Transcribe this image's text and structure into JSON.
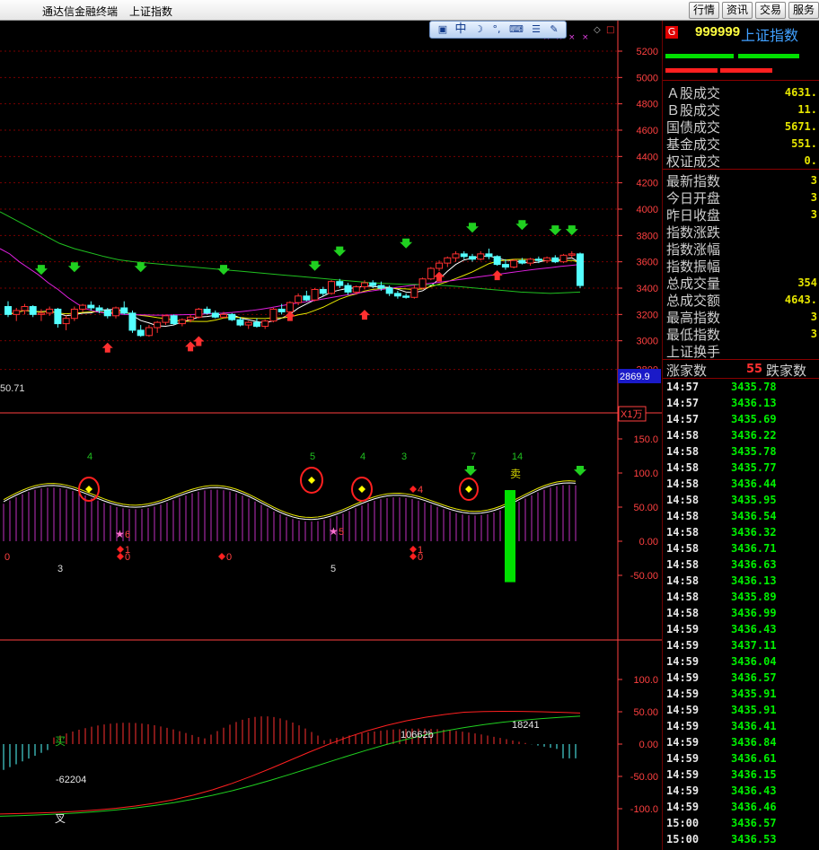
{
  "titlebar": {
    "app_title": "通达信金融终端",
    "page_title": "上证指数",
    "menu": [
      "行情",
      "资讯",
      "交易",
      "服务"
    ]
  },
  "colors": {
    "up": "#ff3030",
    "down": "#54ffff",
    "grid": "#7a0000",
    "axis": "#ff4040",
    "ma_yellow": "#e8e800",
    "ma_magenta": "#e020e0",
    "ma_green": "#20c020",
    "white": "#ffffff",
    "green_text": "#00f000"
  },
  "toolbar": {
    "icons": [
      "settings-icon",
      "chinese-input-icon",
      "moon-icon",
      "symbol-icon",
      "keyboard-icon",
      "menu-icon",
      "wrench-icon"
    ],
    "labels": [
      "中",
      "☽",
      "°,"
    ]
  },
  "main_chart": {
    "y_ticks": [
      5200,
      5000,
      4800,
      4600,
      4400,
      4200,
      4000,
      3800,
      3600,
      3400,
      3200,
      3000,
      2800
    ],
    "price_tag": "2869.9",
    "left_label": "50.71",
    "down_arrows_at": [
      3440,
      3460,
      3460,
      3440,
      3470,
      3580,
      3640,
      3760,
      3780,
      3740,
      3740
    ],
    "up_arrows_at": [
      3040,
      3050,
      3090,
      3280,
      3290,
      3580,
      3590
    ],
    "candles": [
      [
        3260,
        3300,
        3180,
        3200
      ],
      [
        3200,
        3250,
        3150,
        3230
      ],
      [
        3230,
        3280,
        3200,
        3260
      ],
      [
        3260,
        3270,
        3180,
        3200
      ],
      [
        3200,
        3240,
        3150,
        3210
      ],
      [
        3210,
        3260,
        3190,
        3240
      ],
      [
        3240,
        3250,
        3100,
        3130
      ],
      [
        3130,
        3190,
        3080,
        3170
      ],
      [
        3170,
        3260,
        3150,
        3240
      ],
      [
        3240,
        3280,
        3220,
        3270
      ],
      [
        3270,
        3300,
        3230,
        3250
      ],
      [
        3250,
        3270,
        3210,
        3230
      ],
      [
        3230,
        3250,
        3170,
        3190
      ],
      [
        3190,
        3260,
        3170,
        3250
      ],
      [
        3250,
        3300,
        3200,
        3210
      ],
      [
        3210,
        3230,
        3060,
        3080
      ],
      [
        3080,
        3120,
        3030,
        3040
      ],
      [
        3040,
        3120,
        3030,
        3100
      ],
      [
        3100,
        3150,
        3060,
        3140
      ],
      [
        3140,
        3200,
        3120,
        3190
      ],
      [
        3190,
        3200,
        3120,
        3130
      ],
      [
        3130,
        3170,
        3110,
        3160
      ],
      [
        3160,
        3200,
        3140,
        3180
      ],
      [
        3180,
        3250,
        3170,
        3240
      ],
      [
        3240,
        3260,
        3200,
        3210
      ],
      [
        3210,
        3230,
        3170,
        3180
      ],
      [
        3180,
        3220,
        3170,
        3200
      ],
      [
        3200,
        3210,
        3150,
        3160
      ],
      [
        3160,
        3180,
        3110,
        3120
      ],
      [
        3120,
        3150,
        3090,
        3140
      ],
      [
        3140,
        3170,
        3100,
        3110
      ],
      [
        3110,
        3160,
        3090,
        3150
      ],
      [
        3150,
        3250,
        3140,
        3240
      ],
      [
        3240,
        3280,
        3200,
        3220
      ],
      [
        3220,
        3300,
        3210,
        3290
      ],
      [
        3290,
        3360,
        3270,
        3340
      ],
      [
        3340,
        3380,
        3300,
        3310
      ],
      [
        3310,
        3400,
        3300,
        3390
      ],
      [
        3390,
        3410,
        3340,
        3360
      ],
      [
        3360,
        3460,
        3350,
        3450
      ],
      [
        3450,
        3470,
        3400,
        3420
      ],
      [
        3420,
        3440,
        3350,
        3370
      ],
      [
        3370,
        3420,
        3350,
        3410
      ],
      [
        3410,
        3460,
        3390,
        3440
      ],
      [
        3440,
        3460,
        3400,
        3420
      ],
      [
        3420,
        3450,
        3380,
        3400
      ],
      [
        3400,
        3420,
        3340,
        3360
      ],
      [
        3360,
        3380,
        3320,
        3340
      ],
      [
        3340,
        3360,
        3320,
        3330
      ],
      [
        3330,
        3420,
        3320,
        3400
      ],
      [
        3400,
        3480,
        3390,
        3470
      ],
      [
        3470,
        3560,
        3460,
        3550
      ],
      [
        3550,
        3610,
        3530,
        3590
      ],
      [
        3590,
        3640,
        3560,
        3630
      ],
      [
        3630,
        3680,
        3600,
        3660
      ],
      [
        3660,
        3680,
        3620,
        3640
      ],
      [
        3640,
        3660,
        3600,
        3620
      ],
      [
        3620,
        3680,
        3610,
        3660
      ],
      [
        3660,
        3700,
        3620,
        3640
      ],
      [
        3640,
        3650,
        3570,
        3580
      ],
      [
        3580,
        3620,
        3540,
        3560
      ],
      [
        3560,
        3620,
        3550,
        3610
      ],
      [
        3610,
        3630,
        3580,
        3590
      ],
      [
        3590,
        3630,
        3570,
        3620
      ],
      [
        3620,
        3640,
        3590,
        3610
      ],
      [
        3610,
        3640,
        3590,
        3630
      ],
      [
        3630,
        3650,
        3590,
        3600
      ],
      [
        3600,
        3660,
        3590,
        3650
      ],
      [
        3650,
        3680,
        3630,
        3660
      ],
      [
        3660,
        3670,
        3400,
        3420
      ]
    ]
  },
  "oscillator": {
    "y_ticks": [
      "150.0",
      "100.0",
      "50.00",
      "0.00",
      "-50.00"
    ],
    "unit": "X1万",
    "numbers": [
      "4",
      "5",
      "4",
      "3",
      "7",
      "14"
    ],
    "bottom_numbers": [
      "3",
      "5"
    ],
    "markers": [
      "6",
      "5",
      "1",
      "0",
      "0",
      "4",
      "1",
      "0",
      "0"
    ],
    "sell_label": "卖"
  },
  "macd": {
    "y_ticks": [
      "100.0",
      "50.00",
      "0.00",
      "-50.00",
      "-100.0"
    ],
    "labels": [
      "-62204",
      "10662b",
      "18241"
    ],
    "buy_label": "买",
    "cross_label": "叉"
  },
  "panel": {
    "code": "999999",
    "name": "上证指数",
    "g_badge": "G",
    "turnover": [
      {
        "label": "Ａ股成交",
        "value": "4631."
      },
      {
        "label": "Ｂ股成交",
        "value": "11."
      },
      {
        "label": "国债成交",
        "value": "5671."
      },
      {
        "label": "基金成交",
        "value": "551."
      },
      {
        "label": "权证成交",
        "value": "0."
      }
    ],
    "stats": [
      {
        "label": "最新指数",
        "value": "3"
      },
      {
        "label": "今日开盘",
        "value": "3"
      },
      {
        "label": "昨日收盘",
        "value": "3"
      },
      {
        "label": "指数涨跌",
        "value": ""
      },
      {
        "label": "指数涨幅",
        "value": ""
      },
      {
        "label": "指数振幅",
        "value": ""
      },
      {
        "label": "总成交量",
        "value": "354"
      },
      {
        "label": "总成交额",
        "value": "4643."
      },
      {
        "label": "最高指数",
        "value": "3"
      },
      {
        "label": "最低指数",
        "value": "3"
      },
      {
        "label": "上证换手",
        "value": ""
      }
    ],
    "breadth": {
      "rise_label": "涨家数",
      "rise_value": "55",
      "fall_label": "跌家数"
    },
    "ticks": [
      {
        "time": "14:57",
        "price": "3435.78"
      },
      {
        "time": "14:57",
        "price": "3436.13"
      },
      {
        "time": "14:57",
        "price": "3435.69"
      },
      {
        "time": "14:58",
        "price": "3436.22"
      },
      {
        "time": "14:58",
        "price": "3435.78"
      },
      {
        "time": "14:58",
        "price": "3435.77"
      },
      {
        "time": "14:58",
        "price": "3436.44"
      },
      {
        "time": "14:58",
        "price": "3435.95"
      },
      {
        "time": "14:58",
        "price": "3436.54"
      },
      {
        "time": "14:58",
        "price": "3436.32"
      },
      {
        "time": "14:58",
        "price": "3436.71"
      },
      {
        "time": "14:58",
        "price": "3436.63"
      },
      {
        "time": "14:58",
        "price": "3436.13"
      },
      {
        "time": "14:58",
        "price": "3435.89"
      },
      {
        "time": "14:58",
        "price": "3436.99"
      },
      {
        "time": "14:59",
        "price": "3436.43"
      },
      {
        "time": "14:59",
        "price": "3437.11"
      },
      {
        "time": "14:59",
        "price": "3436.04"
      },
      {
        "time": "14:59",
        "price": "3436.57"
      },
      {
        "time": "14:59",
        "price": "3435.91"
      },
      {
        "time": "14:59",
        "price": "3435.91"
      },
      {
        "time": "14:59",
        "price": "3436.41"
      },
      {
        "time": "14:59",
        "price": "3436.84"
      },
      {
        "time": "14:59",
        "price": "3436.61"
      },
      {
        "time": "14:59",
        "price": "3436.15"
      },
      {
        "time": "14:59",
        "price": "3436.43"
      },
      {
        "time": "14:59",
        "price": "3436.46"
      },
      {
        "time": "15:00",
        "price": "3436.57"
      },
      {
        "time": "15:00",
        "price": "3436.53"
      }
    ]
  }
}
